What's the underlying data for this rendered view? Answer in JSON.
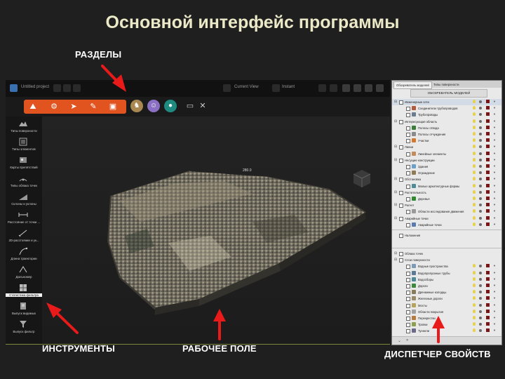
{
  "slide": {
    "title": "Основной интерфейс программы",
    "labels": {
      "sections": "РАЗДЕЛЫ",
      "tools": "ИНСТРУМЕНТЫ",
      "workspace": "РАБОЧЕЕ ПОЛЕ",
      "properties": "ДИСПЕТЧЕР СВОЙСТВ"
    },
    "arrow_color": "#e81a1a"
  },
  "app": {
    "topbar": {
      "doc_label": "Untitled project",
      "center_label": "Current View",
      "right_label": "Instant"
    },
    "ribbon": {
      "accent": "#e2541f",
      "orange_group_icons": [
        "surface-icon",
        "settings-icon",
        "pointer-icon",
        "brush-icon",
        "layers-icon"
      ],
      "circle_icons": [
        {
          "name": "hiker-icon",
          "color": "#a88850"
        },
        {
          "name": "people-icon",
          "color": "#8a6fc2"
        },
        {
          "name": "car-icon",
          "color": "#1f8a80"
        }
      ],
      "right_icons": [
        "monitor-icon",
        "tools-icon"
      ]
    },
    "toolbar": {
      "items": [
        {
          "label": "Типы поверхности",
          "icon": "surface-types-icon"
        },
        {
          "label": "Типы элементов",
          "icon": "element-types-icon"
        },
        {
          "label": "Карты препятствий",
          "icon": "obstacle-map-icon"
        },
        {
          "label": "Типы облака точек",
          "icon": "point-cloud-icon"
        },
        {
          "label": "Склоны и уклоны",
          "icon": "slopes-icon"
        },
        {
          "label": "Расстояние от точки ...",
          "icon": "distance-icon"
        },
        {
          "label": "2D-расстояние и ук...",
          "icon": "ruler-icon"
        },
        {
          "label": "Длина траектории",
          "icon": "trajectory-icon"
        },
        {
          "label": "Дальномер",
          "icon": "rangefinder-icon"
        },
        {
          "label": "Статистика фильтра",
          "icon": "filter-stats-icon"
        },
        {
          "label": "Выпуск видимых",
          "icon": "visible-export-icon"
        },
        {
          "label": "Выпуск фильтр",
          "icon": "filter-export-icon"
        }
      ]
    },
    "workspace": {
      "scale_label": "280.0"
    }
  },
  "panel": {
    "tabs": [
      "Обозреватель моделей",
      "Типы поверхности"
    ],
    "title": "ОБОЗРЕВАТЕЛЬ МОДЕЛЕЙ",
    "model_items": [
      {
        "text": "Инженерные сети",
        "level": 0,
        "icon_color": "",
        "highlight": true
      },
      {
        "text": "Соединители трубопроводов",
        "level": 1,
        "icon_color": "#b35a3a"
      },
      {
        "text": "Трубопроводы",
        "level": 1,
        "icon_color": "#6b7d91"
      },
      {
        "text": "Интересующая область",
        "level": 0,
        "icon_color": ""
      },
      {
        "text": "Полосы отвода",
        "level": 1,
        "icon_color": "#3a7d3a"
      },
      {
        "text": "Полосы отчуждения",
        "level": 1,
        "icon_color": "#8a8a8a"
      },
      {
        "text": "Участки",
        "level": 1,
        "icon_color": "#d4782e"
      },
      {
        "text": "Линии",
        "level": 0,
        "icon_color": ""
      },
      {
        "text": "Линейные элементы",
        "level": 1,
        "icon_color": "#c48a5a"
      },
      {
        "text": "Несущие конструкции",
        "level": 0,
        "icon_color": ""
      },
      {
        "text": "Здания",
        "level": 1,
        "icon_color": "#6aa0c8"
      },
      {
        "text": "Ограждение",
        "level": 1,
        "icon_color": "#8f7a55"
      },
      {
        "text": "Обстановка",
        "level": 0,
        "icon_color": ""
      },
      {
        "text": "Малые архитектурные формы",
        "level": 1,
        "icon_color": "#4f8a9a"
      },
      {
        "text": "Растительность",
        "level": 0,
        "icon_color": ""
      },
      {
        "text": "Деревья",
        "level": 1,
        "icon_color": "#2f8a2f"
      },
      {
        "text": "Расчет",
        "level": 0,
        "icon_color": ""
      },
      {
        "text": "Области исследования движения",
        "level": 1,
        "icon_color": "#9a9a9a"
      },
      {
        "text": "Аварийные точки",
        "level": 0,
        "icon_color": ""
      },
      {
        "text": "Аварийные точки",
        "level": 1,
        "icon_color": "#5a7ab0"
      }
    ],
    "annotations_label": "Наложения",
    "bottom_items": [
      {
        "text": "Облака точек",
        "level": 0,
        "icon_color": ""
      },
      {
        "text": "Слои поверхности",
        "level": 0,
        "icon_color": ""
      },
      {
        "text": "Водные пространства",
        "level": 1,
        "icon_color": "#7a9ab8"
      },
      {
        "text": "Водопропускные трубы",
        "level": 1,
        "icon_color": "#5a7a98"
      },
      {
        "text": "Водосборы",
        "level": 1,
        "icon_color": "#4a8a9a"
      },
      {
        "text": "Дороги",
        "level": 1,
        "icon_color": "#3a8a3a"
      },
      {
        "text": "Дренажные колодцы",
        "level": 1,
        "icon_color": "#8a7a5a"
      },
      {
        "text": "Железные дороги",
        "level": 1,
        "icon_color": "#9a8a6a"
      },
      {
        "text": "Мосты",
        "level": 1,
        "icon_color": "#b8a25a"
      },
      {
        "text": "Области покрытия",
        "level": 1,
        "icon_color": "#a0a0a0"
      },
      {
        "text": "Перекрестки",
        "level": 1,
        "icon_color": "#b87a3a"
      },
      {
        "text": "Тропки",
        "level": 1,
        "icon_color": "#8aa04a"
      },
      {
        "text": "Туннели",
        "level": 1,
        "icon_color": "#6a6a8a"
      }
    ]
  }
}
